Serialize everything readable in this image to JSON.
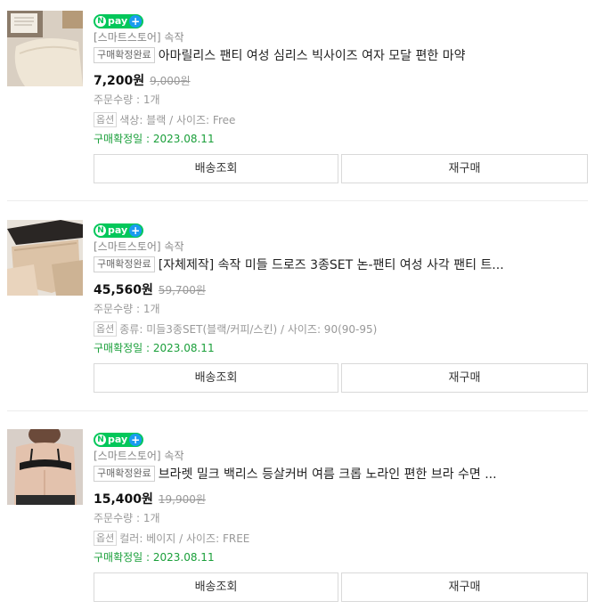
{
  "orders": [
    {
      "npay": "pay",
      "store": "[스마트스토어] 속작",
      "status_badge": "구매확정완료",
      "title": "아마릴리스 팬티 여성 심리스 빅사이즈 여자 모달 편한 마약",
      "price": "7,200원",
      "original_price": "9,000원",
      "quantity": "주문수량 : 1개",
      "option_badge": "옵션",
      "option": "색상: 블랙 / 사이즈: Free",
      "confirm_date": "구매확정일 : 2023.08.11",
      "btn_delivery": "배송조회",
      "btn_rebuy": "재구매"
    },
    {
      "npay": "pay",
      "store": "[스마트스토어] 속작",
      "status_badge": "구매확정완료",
      "title": "[자체제작] 속작 미들 드로즈 3종SET 논-팬티 여성 사각 팬티 트...",
      "price": "45,560원",
      "original_price": "59,700원",
      "quantity": "주문수량 : 1개",
      "option_badge": "옵션",
      "option": "종류: 미들3종SET(블랙/커피/스킨) / 사이즈: 90(90-95)",
      "confirm_date": "구매확정일 : 2023.08.11",
      "btn_delivery": "배송조회",
      "btn_rebuy": "재구매"
    },
    {
      "npay": "pay",
      "store": "[스마트스토어] 속작",
      "status_badge": "구매확정완료",
      "title": "브라렛 밀크 백리스 등살커버 여름 크롭 노라인 편한 브라 수면 ...",
      "price": "15,400원",
      "original_price": "19,900원",
      "quantity": "주문수량 : 1개",
      "option_badge": "옵션",
      "option": "컬러: 베이지 / 사이즈: FREE",
      "confirm_date": "구매확정일 : 2023.08.11",
      "btn_delivery": "배송조회",
      "btn_rebuy": "재구매"
    }
  ],
  "colors": {
    "npay_green": "#03c75a",
    "npay_plus_blue": "#1a9bf0",
    "confirm_green": "#1a9f3a"
  }
}
